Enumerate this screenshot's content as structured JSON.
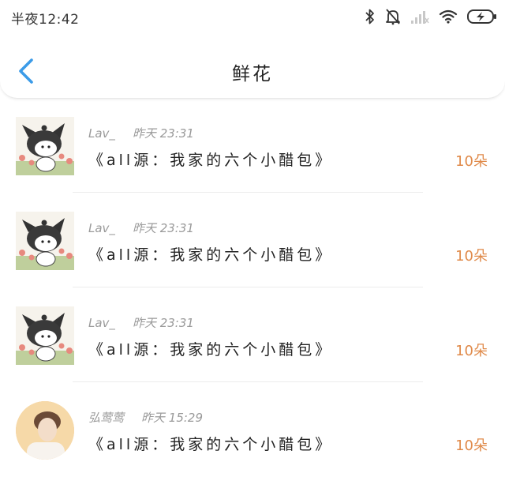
{
  "status_bar": {
    "time": "半夜12:42",
    "icons": [
      "bluetooth-icon",
      "mute-icon",
      "signal-icon",
      "wifi-icon",
      "battery-charging-icon"
    ]
  },
  "nav": {
    "back_icon": "chevron-left-icon",
    "title": "鲜花"
  },
  "colors": {
    "accent": "#3b9be8",
    "amount": "#e08a4a",
    "meta": "#9a9a9a"
  },
  "records": [
    {
      "user": "Lav_",
      "time": "昨天 23:31",
      "message": "《all源：我家的六个小醋包》",
      "amount": "10朵",
      "avatar": "cartoon-character-avatar"
    },
    {
      "user": "Lav_",
      "time": "昨天 23:31",
      "message": "《all源：我家的六个小醋包》",
      "amount": "10朵",
      "avatar": "cartoon-character-avatar"
    },
    {
      "user": "Lav_",
      "time": "昨天 23:31",
      "message": "《all源：我家的六个小醋包》",
      "amount": "10朵",
      "avatar": "cartoon-character-avatar"
    },
    {
      "user": "弘莺莺",
      "time": "昨天 15:29",
      "message": "《all源：我家的六个小醋包》",
      "amount": "10朵",
      "avatar": "portrait-photo-avatar"
    }
  ]
}
